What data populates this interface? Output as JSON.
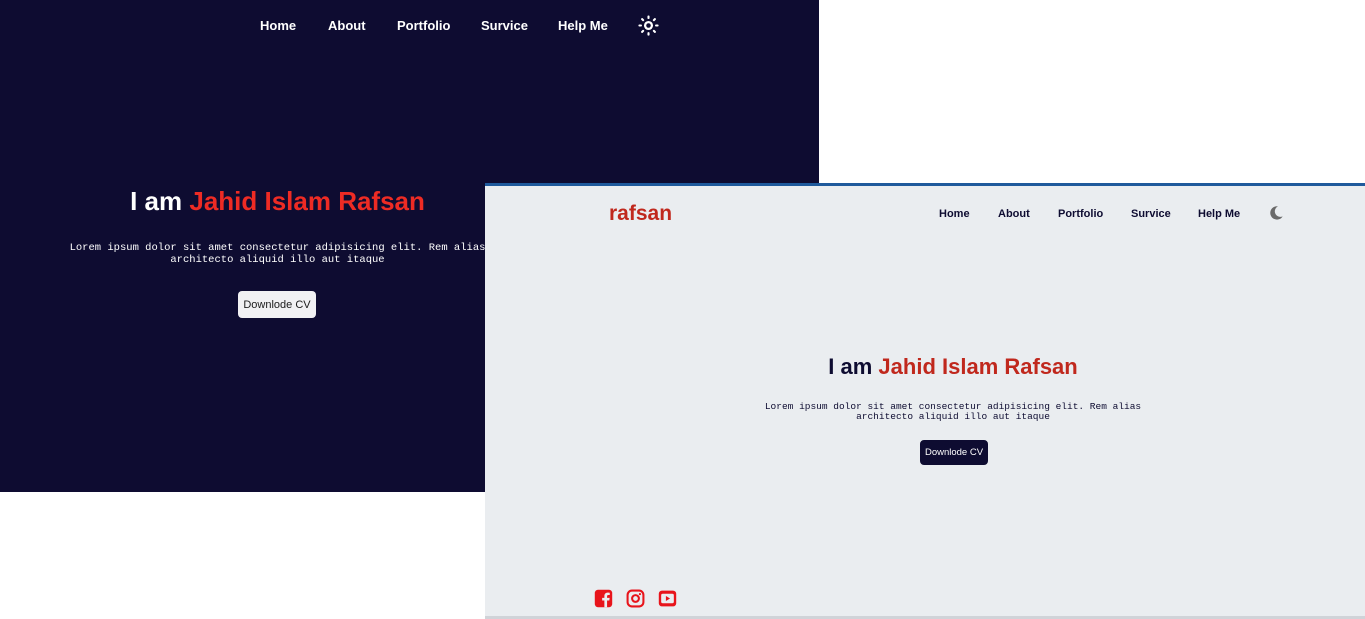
{
  "dark_view": {
    "nav": {
      "items": [
        {
          "label": "Home"
        },
        {
          "label": "About"
        },
        {
          "label": "Portfolio"
        },
        {
          "label": "Survice"
        },
        {
          "label": "Help Me"
        }
      ],
      "theme_toggle_icon": "sun-icon"
    },
    "hero": {
      "intro": "I am",
      "name": "Jahid Islam Rafsan",
      "description_line1": "Lorem ipsum dolor sit amet consectetur adipisicing elit. Rem alias",
      "description_line2": "architecto aliquid illo aut itaque",
      "cv_button": "Downlode CV"
    },
    "colors": {
      "background": "#0e0c31",
      "accent": "#ee2b24",
      "text": "#ffffff"
    }
  },
  "light_view": {
    "logo": "rafsan",
    "nav": {
      "items": [
        {
          "label": "Home"
        },
        {
          "label": "About"
        },
        {
          "label": "Portfolio"
        },
        {
          "label": "Survice"
        },
        {
          "label": "Help Me"
        }
      ],
      "theme_toggle_icon": "moon-icon"
    },
    "hero": {
      "intro": "I am",
      "name": "Jahid Islam Rafsan",
      "description_line1": "Lorem ipsum dolor sit amet consectetur adipisicing elit. Rem alias",
      "description_line2": "architecto aliquid illo aut itaque",
      "cv_button": "Downlode CV"
    },
    "social_icons": [
      "facebook-icon",
      "instagram-icon",
      "youtube-icon"
    ],
    "colors": {
      "background": "#eaedf0",
      "accent": "#c0281d",
      "text": "#0e0c31",
      "social": "#e8141b"
    }
  }
}
